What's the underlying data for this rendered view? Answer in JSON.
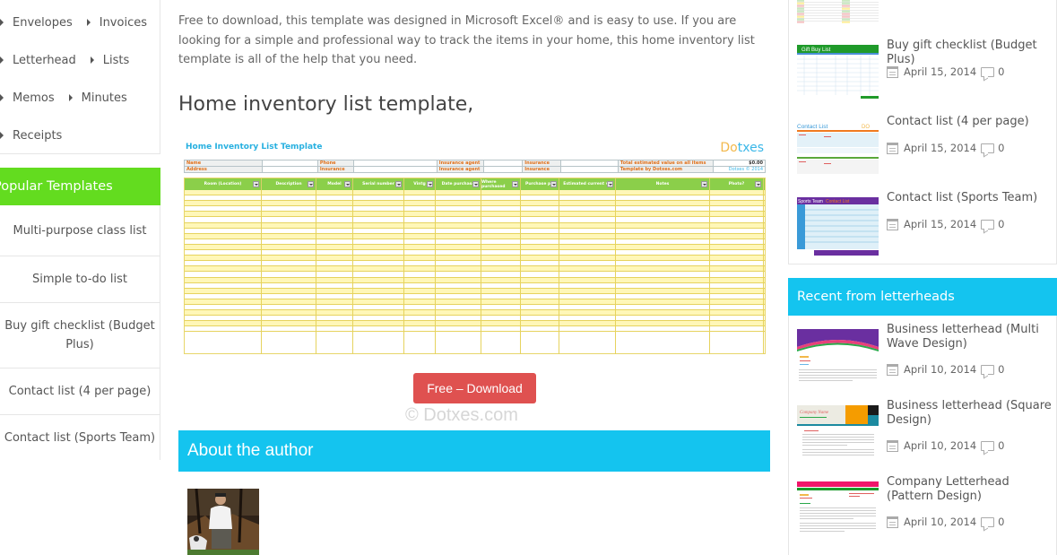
{
  "left_sidebar": {
    "categories": [
      {
        "label": "Envelopes"
      },
      {
        "label": "Invoices"
      },
      {
        "label": "Letterhead"
      },
      {
        "label": "Lists"
      },
      {
        "label": "Memos"
      },
      {
        "label": "Minutes"
      },
      {
        "label": "Receipts"
      }
    ],
    "popular_title": "Popular Templates",
    "popular_items": [
      {
        "label": "Multi-purpose class list"
      },
      {
        "label": "Simple to-do list"
      },
      {
        "label": "Buy gift checklist (Budget Plus)"
      },
      {
        "label": "Contact list (4 per page)"
      },
      {
        "label": "Contact list (Sports Team)"
      }
    ]
  },
  "main": {
    "intro": "Free to download, this template was designed in Microsoft Excel® and is easy to use. If you are looking for a simple and professional way to track the items in your home, this home inventory list template is all of the help that you need.",
    "section_title": "Home inventory list template,",
    "preview": {
      "title": "Home Inventory List Template",
      "logo_a": "Do",
      "logo_b": "txes",
      "info": {
        "name": "Name",
        "address": "Address",
        "phone": "Phone",
        "insurance": "Insurance",
        "agent": "Insurance agent",
        "agent2": "Insurance agent",
        "ins2": "Insurance",
        "ins3": "Insurance",
        "total_label": "Total estimated value on all items",
        "total_value": "$0.00",
        "template_by": "Template by Dotxes.com",
        "copyright": "Dotxes © 2014"
      },
      "columns": [
        "Room (Location)",
        "Description",
        "Model",
        "Serial number",
        "Vintg",
        "Date purchase",
        "Where purchased",
        "Purchase pri",
        "Estimated current va",
        "Notes",
        "Photo?"
      ]
    },
    "download_label": "Free – Download",
    "watermark": "© Dotxes.com",
    "about_title": "About the author"
  },
  "right_sidebar": {
    "recent_posts": [
      {
        "title": "Buy gift checklist (Budget Plus)",
        "date": "April 15, 2014",
        "comments": "0"
      },
      {
        "title": "Contact list (4 per page)",
        "date": "April 15, 2014",
        "comments": "0"
      },
      {
        "title": "Contact list (Sports Team)",
        "date": "April 15, 2014",
        "comments": "0"
      }
    ],
    "letterheads_title": "Recent from letterheads",
    "letterheads": [
      {
        "title": "Business letterhead (Multi Wave Design)",
        "date": "April 10, 2014",
        "comments": "0"
      },
      {
        "title": "Business letterhead (Square Design)",
        "date": "April 10, 2014",
        "comments": "0"
      },
      {
        "title": "Company Letterhead (Pattern Design)",
        "date": "April 10, 2014",
        "comments": "0"
      }
    ]
  },
  "colors": {
    "popular_green": "#63dc1f",
    "accent_cyan": "#14c4ef",
    "download_red": "#df5150"
  }
}
